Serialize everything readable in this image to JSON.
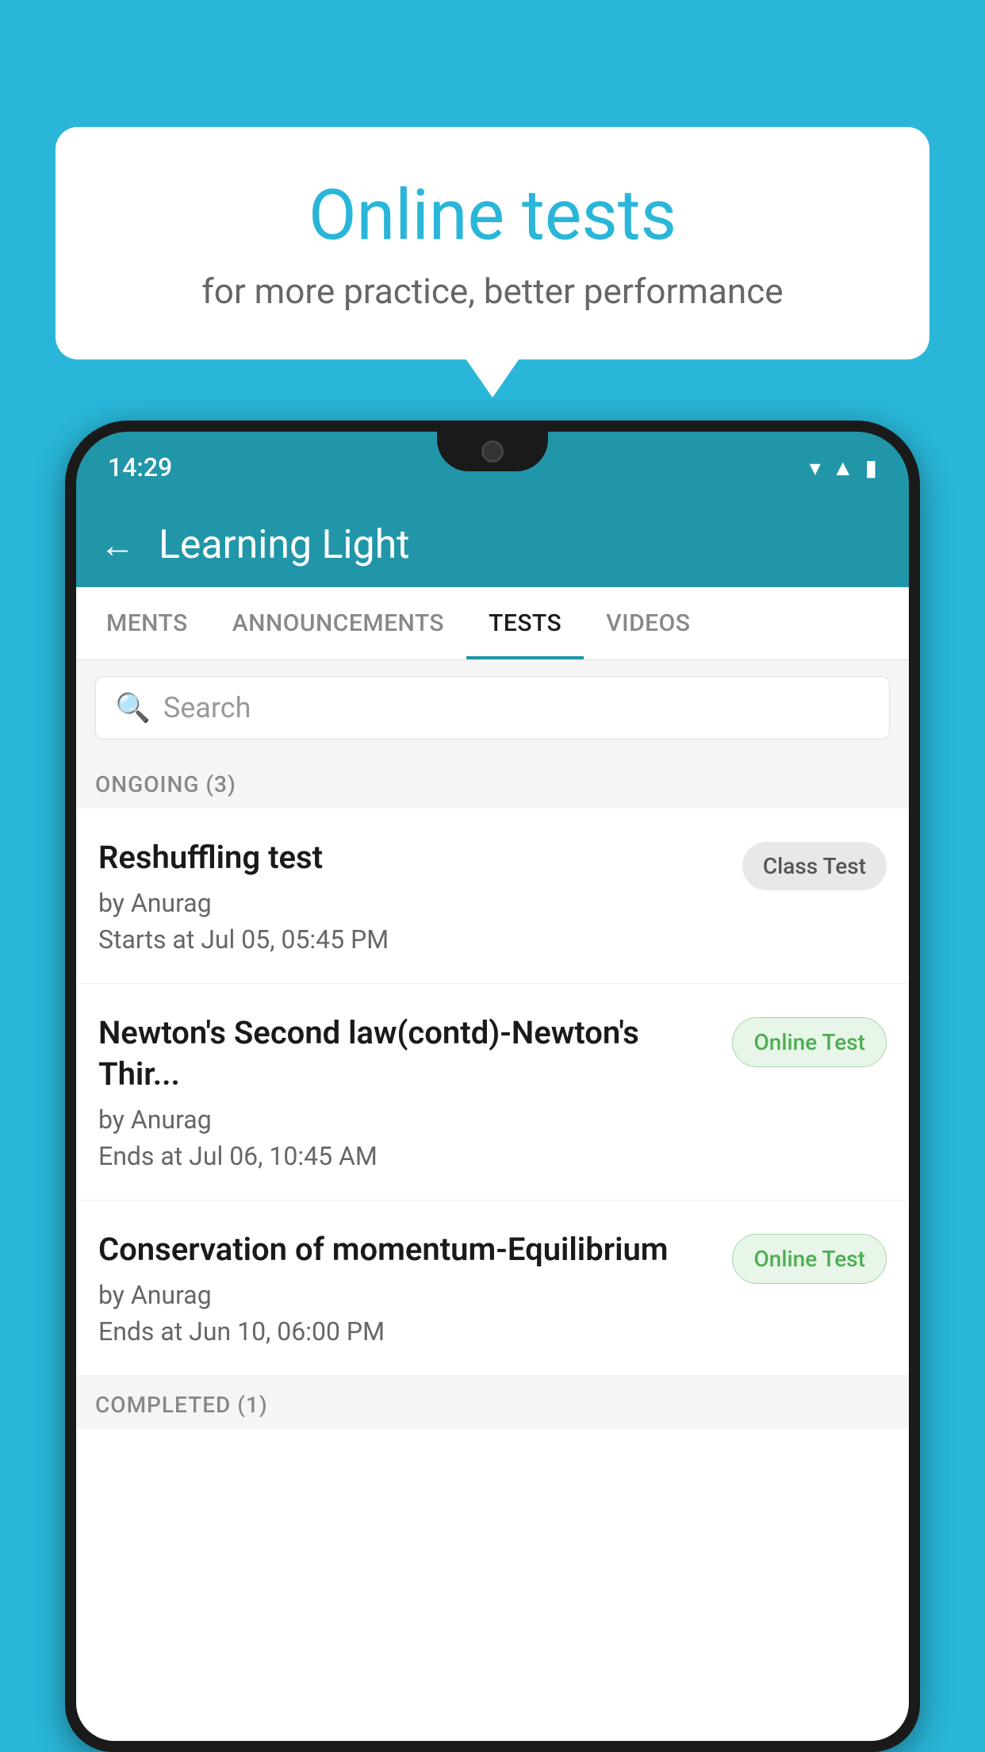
{
  "background": {
    "color": "#29b6d8"
  },
  "bubble": {
    "title": "Online tests",
    "subtitle": "for more practice, better performance"
  },
  "phone": {
    "status": {
      "time": "14:29"
    },
    "header": {
      "back_label": "←",
      "title": "Learning Light"
    },
    "tabs": [
      {
        "label": "MENTS",
        "active": false
      },
      {
        "label": "ANNOUNCEMENTS",
        "active": false
      },
      {
        "label": "TESTS",
        "active": true
      },
      {
        "label": "VIDEOS",
        "active": false
      }
    ],
    "search": {
      "placeholder": "Search"
    },
    "ongoing_section": {
      "label": "ONGOING (3)"
    },
    "tests": [
      {
        "name": "Reshuffling test",
        "author": "by Anurag",
        "date_label": "Starts at",
        "date": "Jul 05, 05:45 PM",
        "badge": "Class Test",
        "badge_type": "class"
      },
      {
        "name": "Newton's Second law(contd)-Newton's Thir...",
        "author": "by Anurag",
        "date_label": "Ends at",
        "date": "Jul 06, 10:45 AM",
        "badge": "Online Test",
        "badge_type": "online"
      },
      {
        "name": "Conservation of momentum-Equilibrium",
        "author": "by Anurag",
        "date_label": "Ends at",
        "date": "Jun 10, 06:00 PM",
        "badge": "Online Test",
        "badge_type": "online"
      }
    ],
    "completed_section": {
      "label": "COMPLETED (1)"
    }
  }
}
